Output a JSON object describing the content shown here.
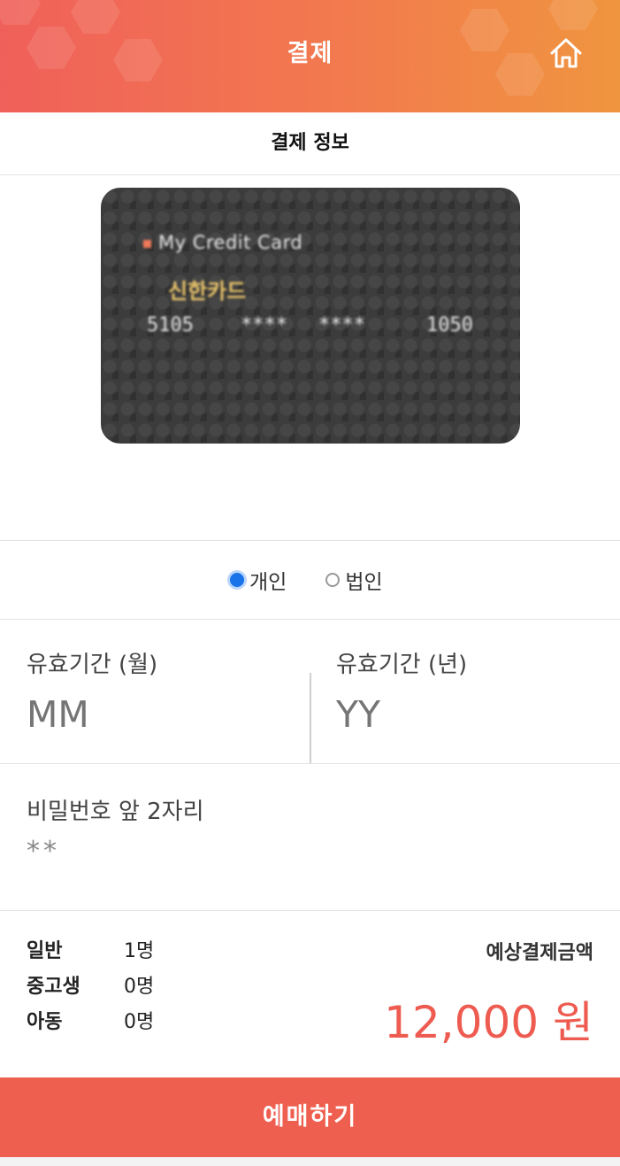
{
  "header": {
    "title": "결제"
  },
  "section": {
    "title": "결제 정보"
  },
  "card": {
    "brand": "My Credit Card",
    "issuer": "신한카드",
    "number_groups": [
      "5105",
      "****",
      "****",
      "1050"
    ]
  },
  "card_type": {
    "options": [
      {
        "label": "개인",
        "selected": true
      },
      {
        "label": "법인",
        "selected": false
      }
    ]
  },
  "expiry": {
    "month_label": "유효기간 (월)",
    "month_placeholder": "MM",
    "year_label": "유효기간 (년)",
    "year_placeholder": "YY"
  },
  "password": {
    "label": "비밀번호 앞 2자리",
    "value": "**"
  },
  "people": [
    {
      "type": "일반",
      "count": "1명"
    },
    {
      "type": "중고생",
      "count": "0명"
    },
    {
      "type": "아동",
      "count": "0명"
    }
  ],
  "estimate": {
    "label": "예상결제금액",
    "amount": "12,000 원"
  },
  "book_button": "예매하기",
  "colors": {
    "accent": "#ef5f50",
    "radio_selected": "#1a73e8"
  }
}
